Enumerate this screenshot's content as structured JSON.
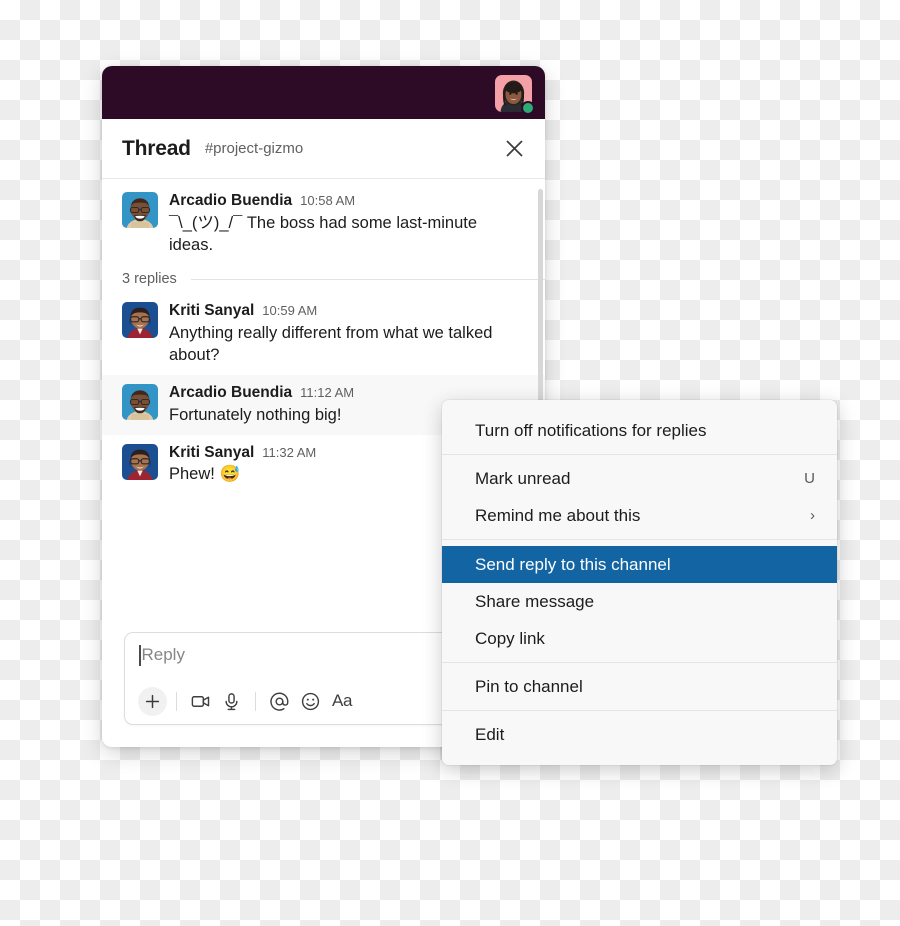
{
  "window": {
    "topbar": {
      "user_avatar": "user-avatar-priya",
      "presence": "online"
    },
    "header": {
      "title": "Thread",
      "channel": "#project-gizmo",
      "close_icon": "close-icon"
    }
  },
  "thread": {
    "root_message": {
      "author": "Arcadio Buendia",
      "time": "10:58 AM",
      "text": "¯\\_(ツ)_/¯ The boss had some last-minute ideas.",
      "avatar": "avatar-arcadio"
    },
    "replies_label": "3 replies",
    "replies": [
      {
        "author": "Kriti Sanyal",
        "time": "10:59 AM",
        "text": "Anything really different from what we talked about?",
        "avatar": "avatar-kriti",
        "hovered": false
      },
      {
        "author": "Arcadio Buendia",
        "time": "11:12 AM",
        "text": "Fortunately nothing big!",
        "avatar": "avatar-arcadio",
        "hovered": true
      },
      {
        "author": "Kriti Sanyal",
        "time": "11:32 AM",
        "text": "Phew! 😅",
        "avatar": "avatar-kriti",
        "hovered": false
      }
    ]
  },
  "composer": {
    "placeholder": "Reply",
    "value": "",
    "toolbar": [
      {
        "name": "add-attachment-button",
        "icon": "plus-icon",
        "glyph": "+"
      },
      {
        "name": "video-clip-button",
        "icon": "video-camera-icon"
      },
      {
        "name": "audio-clip-button",
        "icon": "microphone-icon"
      },
      {
        "name": "mention-button",
        "icon": "at-sign-icon"
      },
      {
        "name": "emoji-button",
        "icon": "smiley-icon"
      },
      {
        "name": "formatting-button",
        "icon": "text-formatting-icon",
        "glyph": "Aa"
      }
    ]
  },
  "context_menu": {
    "groups": [
      {
        "items": [
          {
            "label": "Turn off notifications for replies",
            "accessory": "",
            "chevron": false,
            "selected": false
          }
        ]
      },
      {
        "items": [
          {
            "label": "Mark unread",
            "accessory": "U",
            "chevron": false,
            "selected": false
          },
          {
            "label": "Remind me about this",
            "accessory": "",
            "chevron": true,
            "selected": false
          }
        ]
      },
      {
        "items": [
          {
            "label": "Send reply to this channel",
            "accessory": "",
            "chevron": false,
            "selected": true
          },
          {
            "label": "Share message",
            "accessory": "",
            "chevron": false,
            "selected": false
          },
          {
            "label": "Copy link",
            "accessory": "",
            "chevron": false,
            "selected": false
          }
        ]
      },
      {
        "items": [
          {
            "label": "Pin to channel",
            "accessory": "",
            "chevron": false,
            "selected": false
          }
        ]
      },
      {
        "items": [
          {
            "label": "Edit",
            "accessory": "",
            "chevron": false,
            "selected": false
          }
        ]
      }
    ]
  },
  "colors": {
    "slack_aubergine": "#2d0b27",
    "selection_blue": "#1264a3",
    "presence_green": "#2bac76",
    "text_primary": "#1d1c1d",
    "text_secondary": "#616061",
    "menu_background": "#f8f8f8",
    "hover_row": "#f8f8f8"
  }
}
